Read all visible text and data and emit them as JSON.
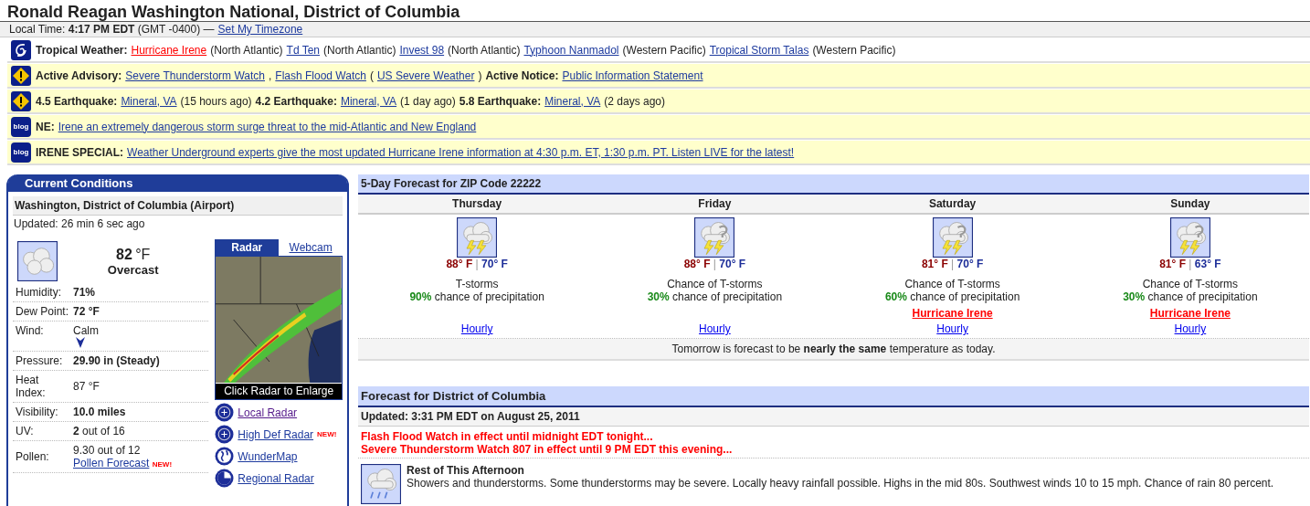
{
  "title": "Ronald Reagan Washington National, District of Columbia",
  "local_time": {
    "label": "Local Time:",
    "time": "4:17 PM EDT",
    "zone": "(GMT -0400) —",
    "link": "Set My Timezone"
  },
  "alerts": [
    {
      "kind": "storm",
      "parts": [
        {
          "kind": "label",
          "text": "Tropical Weather:"
        },
        {
          "kind": "hot-link",
          "text": "Hurricane Irene"
        },
        {
          "kind": "text",
          "text": "(North Atlantic)"
        },
        {
          "kind": "link",
          "text": "Td Ten"
        },
        {
          "kind": "text",
          "text": "(North Atlantic)"
        },
        {
          "kind": "link",
          "text": "Invest 98"
        },
        {
          "kind": "text",
          "text": "(North Atlantic)"
        },
        {
          "kind": "link",
          "text": "Typhoon Nanmadol"
        },
        {
          "kind": "text",
          "text": "(Western Pacific)"
        },
        {
          "kind": "link",
          "text": "Tropical Storm Talas"
        },
        {
          "kind": "text",
          "text": "(Western Pacific)"
        }
      ]
    },
    {
      "kind": "warning",
      "parts": [
        {
          "kind": "label",
          "text": "Active Advisory:"
        },
        {
          "kind": "link",
          "text": "Severe Thunderstorm Watch"
        },
        {
          "kind": "text",
          "text": ","
        },
        {
          "kind": "link",
          "text": "Flash Flood Watch"
        },
        {
          "kind": "text",
          "text": "("
        },
        {
          "kind": "link",
          "text": "US Severe Weather"
        },
        {
          "kind": "text",
          "text": ")"
        },
        {
          "kind": "label",
          "text": "Active Notice:"
        },
        {
          "kind": "link",
          "text": "Public Information Statement"
        }
      ]
    },
    {
      "kind": "warning",
      "parts": [
        {
          "kind": "label",
          "text": "4.5 Earthquake:"
        },
        {
          "kind": "link",
          "text": "Mineral, VA"
        },
        {
          "kind": "text",
          "text": "(15 hours ago)"
        },
        {
          "kind": "label",
          "text": "4.2 Earthquake:"
        },
        {
          "kind": "link",
          "text": "Mineral, VA"
        },
        {
          "kind": "text",
          "text": "(1 day ago)"
        },
        {
          "kind": "label",
          "text": "5.8 Earthquake:"
        },
        {
          "kind": "link",
          "text": "Mineral, VA"
        },
        {
          "kind": "text",
          "text": "(2 days ago)"
        }
      ]
    },
    {
      "kind": "blog",
      "badge": "blog",
      "parts": [
        {
          "kind": "label",
          "text": "NE:"
        },
        {
          "kind": "link",
          "text": "Irene an extremely dangerous storm surge threat to the mid-Atlantic and New England"
        }
      ]
    },
    {
      "kind": "blog",
      "badge": "blog",
      "parts": [
        {
          "kind": "label",
          "text": "IRENE SPECIAL:"
        },
        {
          "kind": "link",
          "text": "Weather Underground experts give the most updated Hurricane Irene information at 4:30 p.m. ET, 1:30 p.m. PT. Listen LIVE for the latest!"
        }
      ]
    }
  ],
  "current": {
    "title": "Current Conditions",
    "location": "Washington, District of Columbia (Airport)",
    "updated": "Updated: 26 min 6 sec ago",
    "temperature": "82",
    "unit": "°F",
    "condition": "Overcast",
    "rows": [
      {
        "kind": "plain",
        "label": "Humidity:",
        "value": "**71%**"
      },
      {
        "kind": "plain",
        "label": "Dew Point:",
        "value": "**72 °F**"
      },
      {
        "kind": "wind",
        "label": "Wind:",
        "value": "Calm"
      },
      {
        "kind": "plain",
        "label": "Pressure:",
        "value": "**29.90 in (Steady)**"
      },
      {
        "kind": "plain",
        "label": "Heat Index:",
        "value": "87 °F"
      },
      {
        "kind": "plain",
        "label": "Visibility:",
        "value": "**10.0 miles**"
      },
      {
        "kind": "plain",
        "label": "UV:",
        "value": "**2** out of 16"
      },
      {
        "kind": "pollen",
        "label": "Pollen:",
        "value": "9.30 out of 12",
        "link": "Pollen Forecast",
        "badge": "NEW!"
      }
    ],
    "tabs": [
      {
        "label": "Radar",
        "selected": true
      },
      {
        "label": "Webcam",
        "selected": false
      }
    ],
    "radar_caption": "Click Radar to Enlarge",
    "links": [
      {
        "kind": "radar",
        "text": "Local Radar",
        "visited": true
      },
      {
        "kind": "radar",
        "text": "High Def Radar",
        "visited": false,
        "badge": "NEW!"
      },
      {
        "kind": "globe",
        "text": "WunderMap",
        "visited": false
      },
      {
        "kind": "regional",
        "text": "Regional Radar",
        "visited": false
      }
    ]
  },
  "five_day": {
    "title": "5-Day Forecast for ZIP Code 22222",
    "days": [
      {
        "name": "Thursday",
        "kind": "storm",
        "high": "88° F",
        "separator": "|",
        "low": "70° F",
        "condition": "T-storms",
        "pop": "90%",
        "pop_text": "chance of precipitation",
        "hourly": "Hourly"
      },
      {
        "name": "Friday",
        "kind": "chance-storm",
        "high": "88° F",
        "separator": "|",
        "low": "70° F",
        "condition": "Chance of T-storms",
        "pop": "30%",
        "pop_text": "chance of precipitation",
        "hourly": "Hourly"
      },
      {
        "name": "Saturday",
        "kind": "chance-storm",
        "high": "81° F",
        "separator": "|",
        "low": "70° F",
        "condition": "Chance of T-storms",
        "pop": "60%",
        "pop_text": "chance of precipitation",
        "alert": "Hurricane Irene",
        "hourly": "Hourly"
      },
      {
        "name": "Sunday",
        "kind": "chance-storm",
        "high": "81° F",
        "separator": "|",
        "low": "63° F",
        "condition": "Chance of T-storms",
        "pop": "30%",
        "pop_text": "chance of precipitation",
        "alert": "Hurricane Irene",
        "hourly": "Hourly"
      }
    ],
    "summary": "Tomorrow is forecast to be **nearly the same** temperature as today."
  },
  "forecast": {
    "title": "Forecast for District of Columbia",
    "updated": "Updated: 3:31 PM EDT on August 25, 2011",
    "warnings": [
      "Flash Flood Watch in effect until midnight EDT tonight...",
      "Severe Thunderstorm Watch 807 in effect until 9 PM EDT this evening..."
    ],
    "periods": [
      {
        "name": "Rest of This Afternoon",
        "text": "Showers and thunderstorms. Some thunderstorms may be severe. Locally heavy rainfall possible. Highs in the mid 80s. Southwest winds 10 to 15 mph. Chance of rain 80 percent."
      }
    ]
  }
}
